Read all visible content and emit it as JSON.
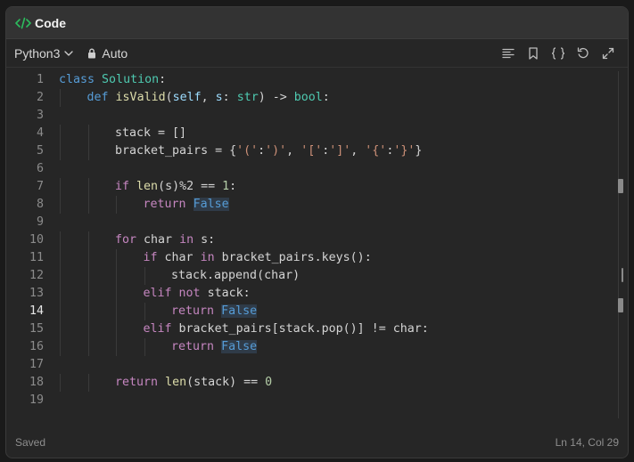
{
  "window": {
    "title": "Code"
  },
  "toolbar": {
    "language": "Python3",
    "mode": "Auto"
  },
  "colors": {
    "accent": "#2cbb5d",
    "keyword": "#c586c0",
    "constant": "#569cd6",
    "string": "#ce9178",
    "number": "#b5cea8"
  },
  "icons": [
    "code-icon",
    "chevron-down-icon",
    "lock-icon",
    "format-icon",
    "bookmark-icon",
    "braces-icon",
    "reset-icon",
    "expand-icon"
  ],
  "editor": {
    "active_line": 14,
    "lines": [
      {
        "n": "1",
        "i": 0,
        "t": [
          [
            "kw2",
            "class"
          ],
          [
            "",
            " "
          ],
          [
            "cls",
            "Solution"
          ],
          [
            "",
            ":"
          ]
        ]
      },
      {
        "n": "2",
        "i": 1,
        "t": [
          [
            "kw2",
            "def"
          ],
          [
            "",
            " "
          ],
          [
            "fn",
            "isValid"
          ],
          [
            "",
            "("
          ],
          [
            "pm",
            "self"
          ],
          [
            "",
            ", "
          ],
          [
            "pm",
            "s"
          ],
          [
            "",
            ": "
          ],
          [
            "cls",
            "str"
          ],
          [
            "",
            ") -> "
          ],
          [
            "cls",
            "bool"
          ],
          [
            "",
            ":"
          ]
        ]
      },
      {
        "n": "3",
        "i": 0,
        "t": []
      },
      {
        "n": "4",
        "i": 2,
        "t": [
          [
            "",
            "stack = []"
          ]
        ]
      },
      {
        "n": "5",
        "i": 2,
        "t": [
          [
            "",
            "bracket_pairs = {"
          ],
          [
            "str",
            "'('"
          ],
          [
            "",
            ":"
          ],
          [
            "str",
            "')'"
          ],
          [
            "",
            ", "
          ],
          [
            "str",
            "'['"
          ],
          [
            "",
            ":"
          ],
          [
            "str",
            "']'"
          ],
          [
            "",
            ", "
          ],
          [
            "str",
            "'{'"
          ],
          [
            "",
            ":"
          ],
          [
            "str",
            "'}'"
          ],
          [
            "",
            "}"
          ]
        ]
      },
      {
        "n": "6",
        "i": 0,
        "t": []
      },
      {
        "n": "7",
        "i": 2,
        "t": [
          [
            "kw",
            "if"
          ],
          [
            "",
            " "
          ],
          [
            "fn",
            "len"
          ],
          [
            "",
            "(s)%2 == "
          ],
          [
            "num",
            "1"
          ],
          [
            "",
            ":"
          ]
        ]
      },
      {
        "n": "8",
        "i": 3,
        "t": [
          [
            "kw",
            "return"
          ],
          [
            "",
            " "
          ],
          [
            "const",
            "False"
          ]
        ]
      },
      {
        "n": "9",
        "i": 0,
        "t": []
      },
      {
        "n": "10",
        "i": 2,
        "t": [
          [
            "kw",
            "for"
          ],
          [
            "",
            " char "
          ],
          [
            "kw",
            "in"
          ],
          [
            "",
            ""
          ],
          [
            "",
            " s:"
          ]
        ]
      },
      {
        "n": "11",
        "i": 3,
        "t": [
          [
            "kw",
            "if"
          ],
          [
            "",
            ""
          ],
          [
            "",
            " char "
          ],
          [
            "kw",
            "in"
          ],
          [
            "",
            ""
          ],
          [
            "",
            " bracket_pairs.keys():"
          ]
        ]
      },
      {
        "n": "12",
        "i": 4,
        "t": [
          [
            "",
            "stack.append(char)"
          ]
        ]
      },
      {
        "n": "13",
        "i": 3,
        "t": [
          [
            "kw",
            "elif"
          ],
          [
            "",
            " "
          ],
          [
            "kw",
            "not"
          ],
          [
            "",
            " stack:"
          ]
        ]
      },
      {
        "n": "14",
        "i": 4,
        "t": [
          [
            "kw",
            "return"
          ],
          [
            "",
            " "
          ],
          [
            "const",
            "False"
          ]
        ]
      },
      {
        "n": "15",
        "i": 3,
        "t": [
          [
            "kw",
            "elif"
          ],
          [
            "",
            " bracket_pairs[stack.pop()] != char:"
          ]
        ]
      },
      {
        "n": "16",
        "i": 4,
        "t": [
          [
            "kw",
            "return"
          ],
          [
            "",
            " "
          ],
          [
            "const",
            "False"
          ]
        ]
      },
      {
        "n": "17",
        "i": 0,
        "t": []
      },
      {
        "n": "18",
        "i": 2,
        "t": [
          [
            "kw",
            "return"
          ],
          [
            "",
            " "
          ],
          [
            "fn",
            "len"
          ],
          [
            "",
            "(stack) == "
          ],
          [
            "num",
            "0"
          ]
        ]
      },
      {
        "n": "19",
        "i": 0,
        "t": []
      }
    ]
  },
  "status": {
    "left": "Saved",
    "right": "Ln 14, Col 29"
  }
}
